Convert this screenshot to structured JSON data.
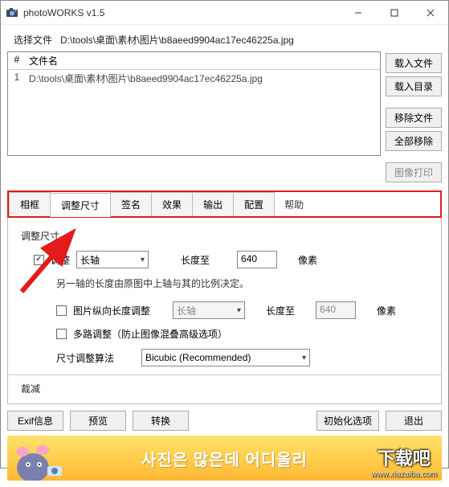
{
  "window": {
    "title": "photoWORKS v1.5"
  },
  "path": {
    "label": "选择文件",
    "value": "D:\\tools\\桌面\\素材\\图片\\b8aeed9904ac17ec46225a.jpg"
  },
  "filelist": {
    "col_num": "#",
    "col_name": "文件名",
    "rows": [
      {
        "num": "1",
        "name": "D:\\tools\\桌面\\素材\\图片\\b8aeed9904ac17ec46225a.jpg"
      }
    ]
  },
  "side_buttons": {
    "load_file": "载入文件",
    "load_dir": "载入目录",
    "remove_file": "移除文件",
    "remove_all": "全部移除",
    "image_print": "图像打印"
  },
  "tabs": {
    "frame": "相框",
    "resize": "调整尺寸",
    "signature": "签名",
    "effects": "效果",
    "output": "输出",
    "config": "配置",
    "help": "帮助"
  },
  "resize_panel": {
    "group_label": "调整尺寸",
    "adjust_label": "调整",
    "axis_select": "长轴",
    "length_to": "长度至",
    "length_value": "640",
    "pixel": "像素",
    "note": "另一轴的长度由原图中上轴与其的比例决定。",
    "portrait_adjust": "图片纵向长度调整",
    "axis2_select": "长轴",
    "length_to2": "长度至",
    "length_value2": "640",
    "pixel2": "像素",
    "multipass": "多路调整（防止图像混叠高级选项）",
    "algo_label": "尺寸调整算法",
    "algo_value": "Bicubic (Recommended)",
    "crop_label": "裁减"
  },
  "bottom": {
    "exif": "Exif信息",
    "preview": "预览",
    "convert": "转换",
    "init_options": "初始化选项",
    "exit": "退出"
  },
  "banner": {
    "text": "사진은 많은데 어디올리",
    "overlay_big": "下载吧",
    "overlay_small": "www.xiazaiba.com"
  }
}
